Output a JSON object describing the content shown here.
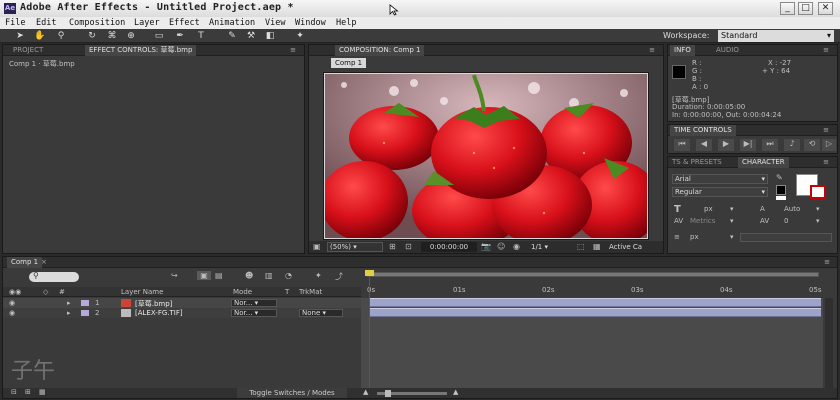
{
  "window": {
    "title": "Adobe After Effects - Untitled Project.aep *",
    "icon": "Ae",
    "min": "_",
    "max": "□",
    "close": "✕"
  },
  "menu": [
    "File",
    "Edit",
    "Composition",
    "Layer",
    "Effect",
    "Animation",
    "View",
    "Window",
    "Help"
  ],
  "toolbar": {
    "workspace_label": "Workspace:",
    "workspace_value": "Standard"
  },
  "project_panel": {
    "tab_project": "PROJECT",
    "tab_effects": "EFFECT CONTROLS: 草莓.bmp",
    "breadcrumb": "Comp 1 · 草莓.bmp"
  },
  "comp_panel": {
    "tab": "COMPOSITION: Comp 1",
    "subtab": "Comp 1",
    "zoom": "(50%)",
    "timecode": "0:00:00:00",
    "resolution": "1/1",
    "camera": "Active Ca"
  },
  "info_panel": {
    "tab_info": "INFO",
    "tab_audio": "AUDIO",
    "r": "R :",
    "g": "G :",
    "b": "B :",
    "a": "A : 0",
    "x": "X : -27",
    "y": "+ Y : 64",
    "file": "[草莓.bmp]",
    "duration": "Duration: 0:00:05:00",
    "inout": "In: 0:00:00:00, Out: 0:00:04:24"
  },
  "time_controls": {
    "tab": "TIME CONTROLS"
  },
  "character_panel": {
    "tab_presets": "TS & PRESETS",
    "tab_character": "CHARACTER",
    "font": "Arial",
    "style": "Regular",
    "size_unit": "px",
    "leading": "Auto",
    "metrics": "Metrics",
    "tracking": "0",
    "stroke_unit": "px"
  },
  "timeline": {
    "tab": "Comp 1",
    "search_placeholder": "",
    "col_layer": "Layer Name",
    "col_mode": "Mode",
    "col_t": "T",
    "col_trkmat": "TrkMat",
    "ruler": [
      "0s",
      "01s",
      "02s",
      "03s",
      "04s",
      "05s"
    ],
    "layers": [
      {
        "num": "1",
        "name": "[草莓.bmp]",
        "mode": "Nor...",
        "trkmat": ""
      },
      {
        "num": "2",
        "name": "[ALEX-FG.TIF]",
        "mode": "Nor...",
        "trkmat": "None"
      }
    ],
    "toggle": "Toggle Switches / Modes"
  },
  "watermark": "子午"
}
